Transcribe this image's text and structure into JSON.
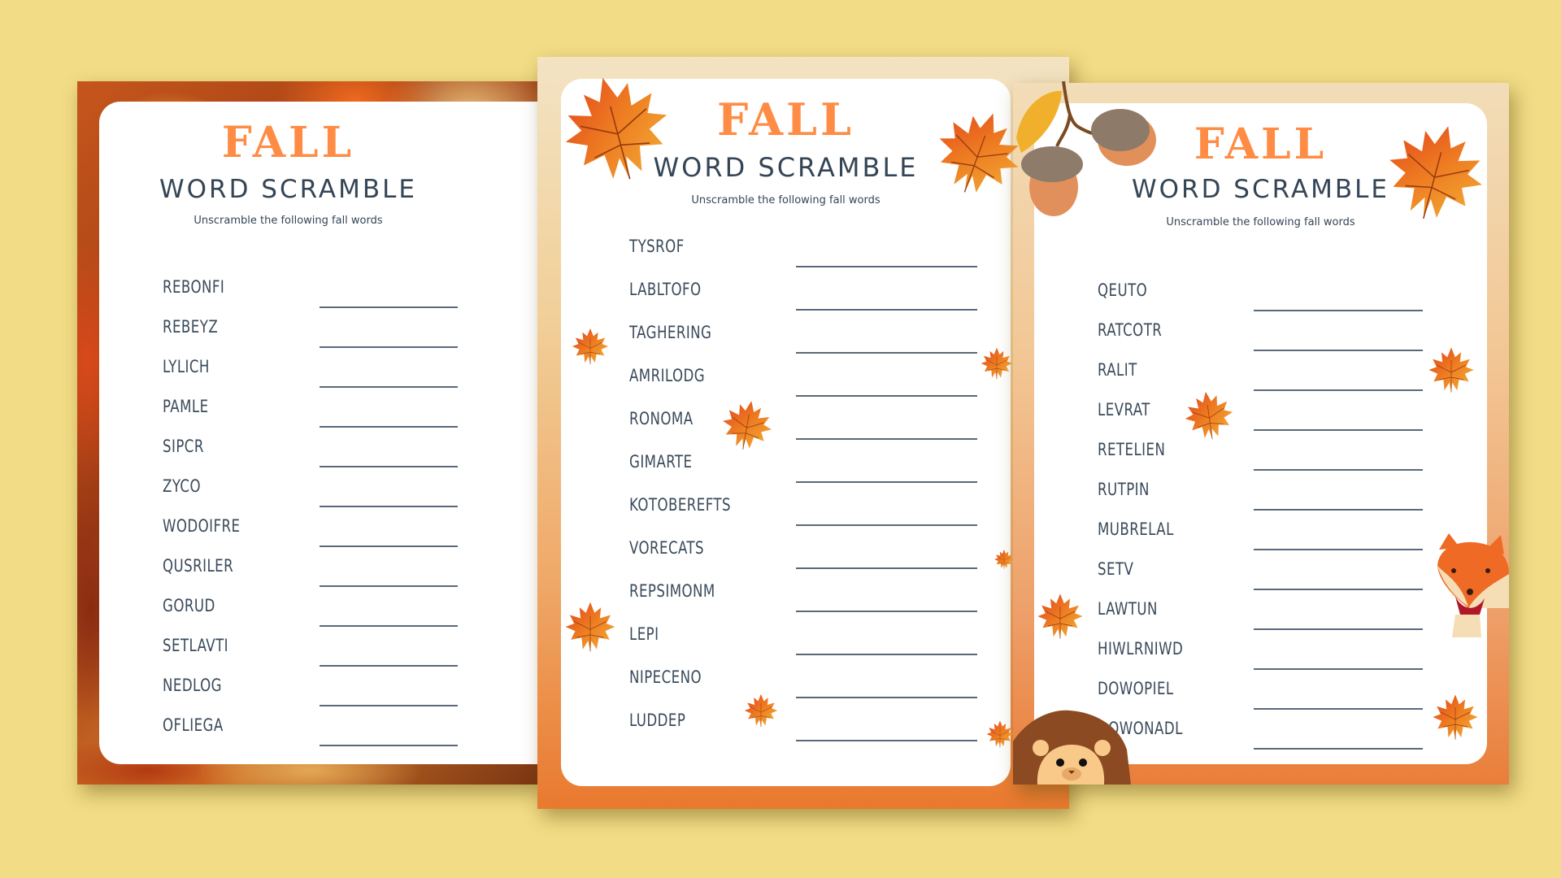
{
  "background_color": "#F2DC85",
  "colors": {
    "title_orange": "#FF8C45",
    "text_slate": "#344556",
    "line_gray": "#59697A"
  },
  "worksheets": [
    {
      "name": "left",
      "title": "FALL",
      "subtitle": "WORD SCRAMBLE",
      "instructions": "Unscramble the following fall words",
      "words": [
        "REBONFI",
        "REBEYZ",
        "LYLICH",
        "PAMLE",
        "SIPCR",
        "ZYCO",
        "WODOIFRE",
        "QUSRILER",
        "GORUD",
        "SETLAVTI",
        "NEDLOG",
        "OFLIEGA"
      ]
    },
    {
      "name": "middle",
      "title": "FALL",
      "subtitle": "WORD SCRAMBLE",
      "instructions": "Unscramble the following fall words",
      "words": [
        "TYSROF",
        "LABLTOFO",
        "TAGHERING",
        "AMRILODG",
        "RONOMA",
        "GIMARTE",
        "KOTOBEREFTS",
        "VORECATS",
        "REPSIMONM",
        "LEPI",
        "NIPECENO",
        "LUDDEP"
      ]
    },
    {
      "name": "right",
      "title": "FALL",
      "subtitle": "WORD SCRAMBLE",
      "instructions": "Unscramble the following fall words",
      "words": [
        "QEUTO",
        "RATCOTR",
        "RALIT",
        "LEVRAT",
        "RETELIEN",
        "RUTPIN",
        "MUBRELAL",
        "SETV",
        "LAWTUN",
        "HIWLRNIWD",
        "DOWOPIEL",
        "DOWONADL"
      ]
    }
  ],
  "decorations": [
    "maple-leaf-icon",
    "acorn-icon",
    "oak-leaf-icon",
    "fox-icon",
    "hedgehog-icon"
  ]
}
